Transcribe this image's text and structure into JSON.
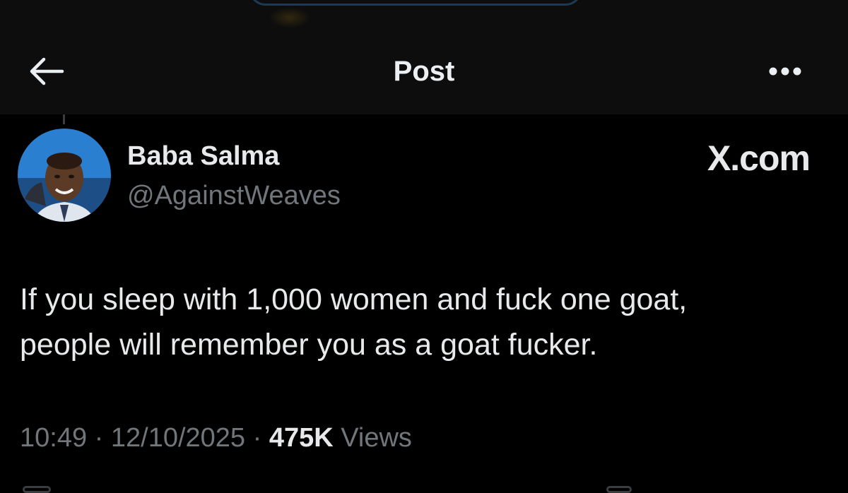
{
  "header": {
    "title": "Post",
    "back_icon": "arrow-left-icon",
    "more_icon": "more-horizontal-icon"
  },
  "author": {
    "display_name": "Baba Salma",
    "handle": "@AgainstWeaves",
    "avatar_icon": "user-avatar"
  },
  "watermark": {
    "text": "X.com"
  },
  "post": {
    "text": "If you sleep with 1,000 women and fuck one goat,\npeople will remember you as a goat fucker."
  },
  "meta": {
    "time": "10:49",
    "separator": " · ",
    "date": "12/10/2025",
    "views_count": "475K",
    "views_label": "Views"
  },
  "colors": {
    "background": "#000000",
    "header_background": "#0d0d0d",
    "primary_text": "#e7e9ea",
    "secondary_text": "#71767b",
    "avatar_background": "#2b7fd0"
  }
}
